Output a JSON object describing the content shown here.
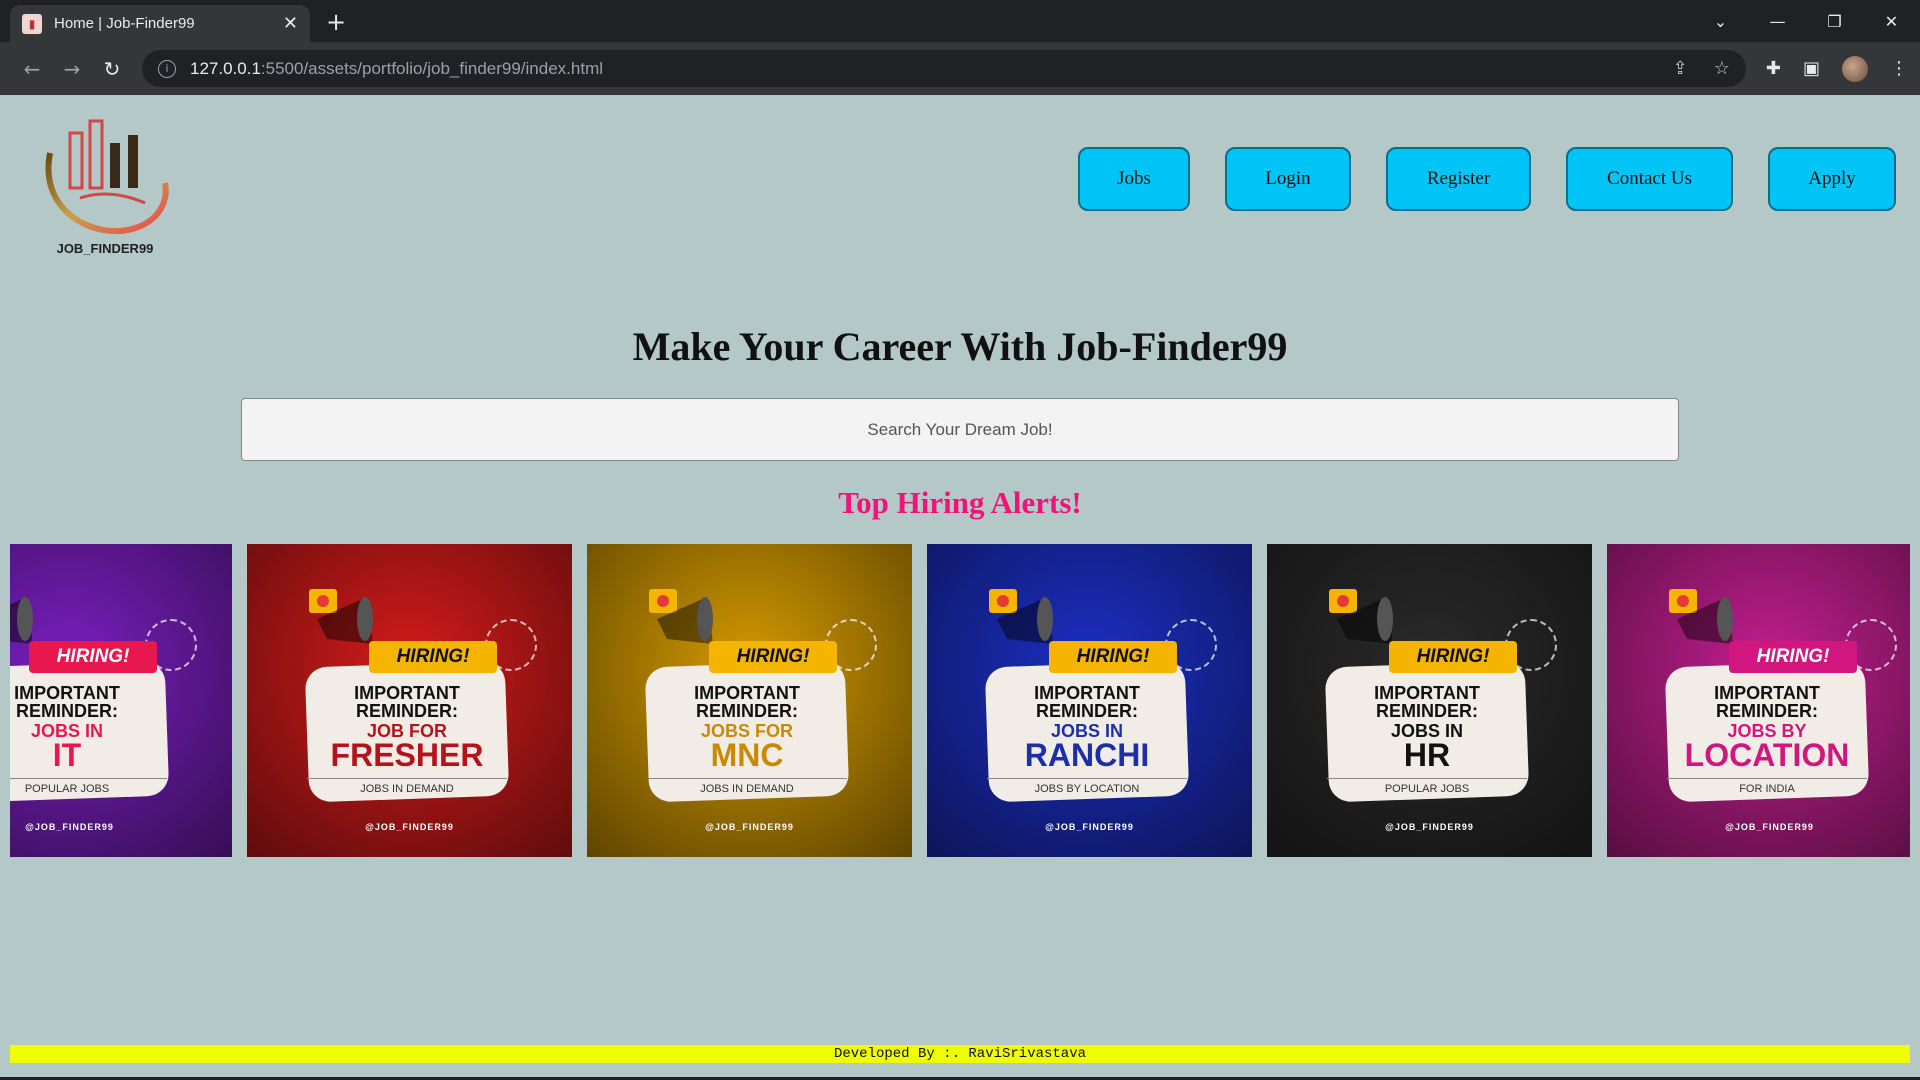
{
  "browser": {
    "tab_title": "Home | Job-Finder99",
    "url_host": "127.0.0.1",
    "url_path": ":5500/assets/portfolio/job_finder99/index.html"
  },
  "logo": {
    "text": "JOB_FINDER99"
  },
  "nav": {
    "items": [
      "Jobs",
      "Login",
      "Register",
      "Contact Us",
      "Apply"
    ]
  },
  "hero": {
    "title": "Make Your Career With Job-Finder99",
    "search_placeholder": "Search Your Dream Job!",
    "alerts_title": "Top Hiring Alerts!"
  },
  "cards": [
    {
      "hiring": "HIRING!",
      "reminder": "IMPORTANT REMINDER:",
      "line1": "JOBS IN",
      "line2": "IT",
      "sub": "POPULAR JOBS",
      "handle": "@JOB_FINDER99",
      "bg": "#7a1fbf",
      "accent": "#e8174f",
      "accent_text": "#e8174f"
    },
    {
      "hiring": "HIRING!",
      "reminder": "IMPORTANT REMINDER:",
      "line1": "JOB FOR",
      "line2": "FRESHER",
      "sub": "JOBS IN DEMAND",
      "handle": "@JOB_FINDER99",
      "bg": "#d51b1b",
      "accent": "#f4b400",
      "accent_text": "#b5121b"
    },
    {
      "hiring": "HIRING!",
      "reminder": "IMPORTANT REMINDER:",
      "line1": "JOBS FOR",
      "line2": "MNC",
      "sub": "JOBS IN DEMAND",
      "handle": "@JOB_FINDER99",
      "bg": "#d39a00",
      "accent": "#f4b400",
      "accent_text": "#c98a00"
    },
    {
      "hiring": "HIRING!",
      "reminder": "IMPORTANT REMINDER:",
      "line1": "JOBS IN",
      "line2": "RANCHI",
      "sub": "JOBS BY LOCATION",
      "handle": "@JOB_FINDER99",
      "bg": "#1c2fc4",
      "accent": "#f4b400",
      "accent_text": "#1c2fa8"
    },
    {
      "hiring": "HIRING!",
      "reminder": "IMPORTANT REMINDER:",
      "line1": "JOBS IN",
      "line2": "HR",
      "sub": "POPULAR JOBS",
      "handle": "@JOB_FINDER99",
      "bg": "#2a2a2a",
      "accent": "#f4b400",
      "accent_text": "#111111"
    },
    {
      "hiring": "HIRING!",
      "reminder": "IMPORTANT REMINDER:",
      "line1": "JOBS BY",
      "line2": "LOCATION",
      "sub": "FOR INDIA",
      "handle": "@JOB_FINDER99",
      "bg": "#c21f8f",
      "accent": "#d1167f",
      "accent_text": "#d1167f"
    }
  ],
  "footer": {
    "text": "Developed By :. RaviSrivastava"
  }
}
